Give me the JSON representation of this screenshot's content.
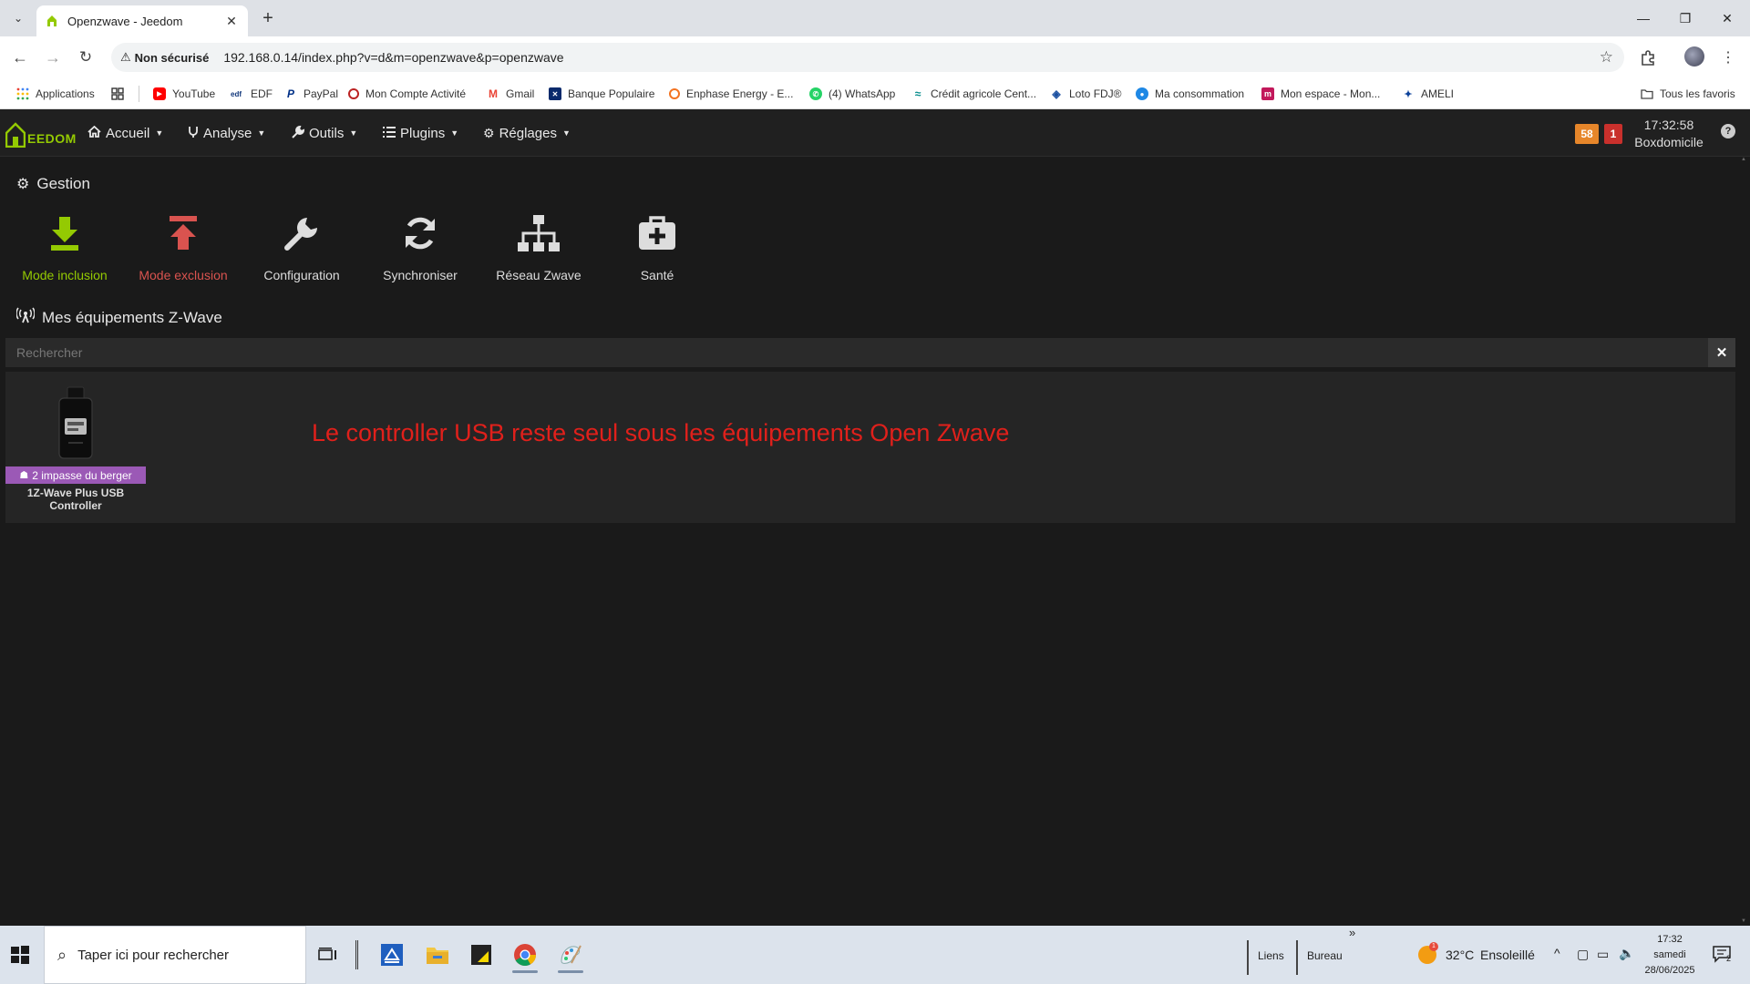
{
  "browser": {
    "tab_title": "Openzwave - Jeedom",
    "security_label": "Non sécurisé",
    "url": "192.168.0.14/index.php?v=d&m=openzwave&p=openzwave"
  },
  "bookmarks": {
    "items": [
      {
        "label": "Applications",
        "icon": "apps-grid-icon"
      },
      {
        "label": "YouTube",
        "icon": "youtube-icon",
        "color": "#ff0000"
      },
      {
        "label": "EDF",
        "icon": "edf-icon"
      },
      {
        "label": "PayPal",
        "icon": "paypal-icon",
        "color": "#003087"
      },
      {
        "label": "Mon Compte Activité",
        "icon": "activite-icon"
      },
      {
        "label": "Gmail",
        "icon": "gmail-icon"
      },
      {
        "label": "Banque Populaire",
        "icon": "banque-populaire-icon"
      },
      {
        "label": "Enphase Energy - E...",
        "icon": "enphase-icon"
      },
      {
        "label": "(4) WhatsApp",
        "icon": "whatsapp-icon"
      },
      {
        "label": "Crédit agricole Cent...",
        "icon": "credit-agricole-icon"
      },
      {
        "label": "Loto FDJ®",
        "icon": "loto-icon"
      },
      {
        "label": "Ma consommation",
        "icon": "map-pin-icon"
      },
      {
        "label": "Mon espace - Mon...",
        "icon": "mon-espace-icon"
      },
      {
        "label": "AMELI",
        "icon": "ameli-icon"
      }
    ],
    "all_bookmarks": "Tous les favoris"
  },
  "jeedom": {
    "logo_text": "EEDOM",
    "menu": [
      "Accueil",
      "Analyse",
      "Outils",
      "Plugins",
      "Réglages"
    ],
    "badge_warning": "58",
    "badge_danger": "1",
    "time": "17:32:58",
    "box_name": "Boxdomicile",
    "help": "?"
  },
  "gestion": {
    "title": "Gestion",
    "actions": [
      {
        "label": "Mode inclusion",
        "color": "#94ca02"
      },
      {
        "label": "Mode exclusion",
        "color": "#d9534f"
      },
      {
        "label": "Configuration",
        "color": "#dddddd"
      },
      {
        "label": "Synchroniser",
        "color": "#dddddd"
      },
      {
        "label": "Réseau Zwave",
        "color": "#dddddd"
      },
      {
        "label": "Santé",
        "color": "#dddddd"
      }
    ]
  },
  "equipments": {
    "title": "Mes équipements Z-Wave",
    "search_placeholder": "Rechercher",
    "items": [
      {
        "object": "2 impasse du berger",
        "name_line1": "1Z-Wave Plus USB",
        "name_line2": "Controller"
      }
    ],
    "annotation": "Le controller USB reste seul sous les équipements Open Zwave"
  },
  "taskbar": {
    "search_placeholder": "Taper ici pour rechercher",
    "links": "Liens",
    "bureau": "Bureau",
    "chevron": "»",
    "weather_temp": "32°C",
    "weather_text": "Ensoleillé",
    "time": "17:32",
    "day": "samedi",
    "date": "28/06/2025",
    "notifications": "2"
  },
  "colors": {
    "accent_green": "#94ca02",
    "accent_red": "#d9534f",
    "badge_orange": "#e6862a",
    "badge_red": "#c9302c",
    "object_purple": "#9b59b6",
    "annotation_red": "#e0201b"
  }
}
